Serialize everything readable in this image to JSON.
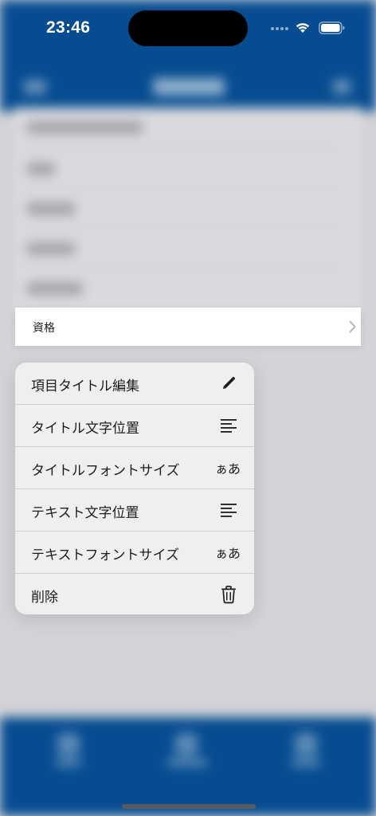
{
  "status_bar": {
    "time": "23:46"
  },
  "selected_row": {
    "label": "資格"
  },
  "context_menu": {
    "items": [
      {
        "label": "項目タイトル編集",
        "icon": "pencil-icon"
      },
      {
        "label": "タイトル文字位置",
        "icon": "text-align-left-icon"
      },
      {
        "label": "タイトルフォントサイズ",
        "icon": "font-size-icon",
        "icon_text": "ぁあ"
      },
      {
        "label": "テキスト文字位置",
        "icon": "text-align-left-icon"
      },
      {
        "label": "テキストフォントサイズ",
        "icon": "font-size-icon",
        "icon_text": "ぁあ"
      },
      {
        "label": "削除",
        "icon": "trash-icon"
      }
    ]
  },
  "colors": {
    "header_blue": "#064c90",
    "menu_bg": "#efeff0",
    "dim_bg": "#d3d3d8"
  }
}
